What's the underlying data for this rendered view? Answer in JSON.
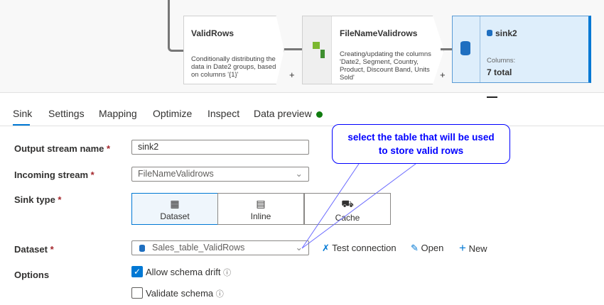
{
  "pipeline": {
    "nodes": [
      {
        "title": "ValidRows",
        "description": "Conditionally distributing the data in Date2 groups, based on columns '{1}'"
      },
      {
        "title": "FileNameValidrows",
        "description": "Creating/updating the columns 'Date2, Segment, Country, Product, Discount Band, Units Sold'"
      },
      {
        "title": "sink2",
        "columns_label": "Columns:",
        "columns_value": "7 total"
      }
    ],
    "add_symbol": "+"
  },
  "tabs": [
    "Sink",
    "Settings",
    "Mapping",
    "Optimize",
    "Inspect",
    "Data preview"
  ],
  "form": {
    "output_stream_label": "Output stream name",
    "output_stream_value": "sink2",
    "incoming_stream_label": "Incoming stream",
    "incoming_stream_value": "FileNameValidrows",
    "sink_type_label": "Sink type",
    "sink_types": [
      "Dataset",
      "Inline",
      "Cache"
    ],
    "dataset_label": "Dataset",
    "dataset_value": "Sales_table_ValidRows",
    "test_connection": "Test connection",
    "open": "Open",
    "new": "New",
    "options_label": "Options",
    "allow_schema_drift": "Allow schema drift",
    "validate_schema": "Validate schema",
    "required_mark": "*"
  },
  "callout": {
    "line1": "select the table that will be used",
    "line2": "to store valid rows"
  },
  "colors": {
    "accent": "#0078d4",
    "status_dot": "#107c10",
    "callout": "#0000ff"
  }
}
